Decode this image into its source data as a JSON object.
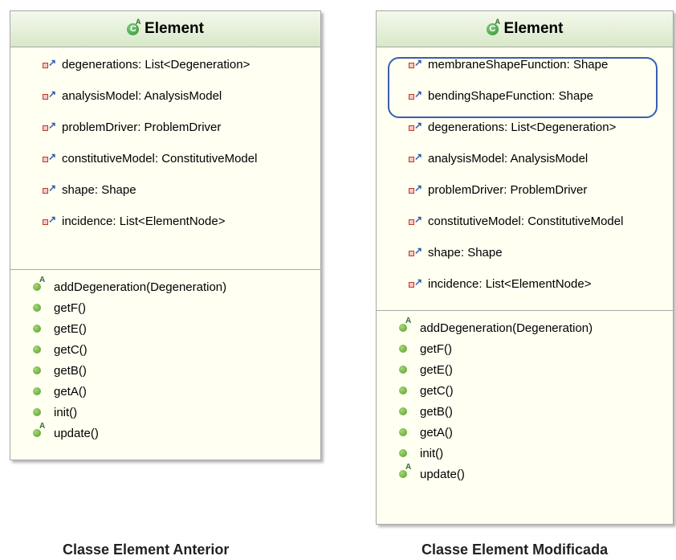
{
  "left_class": {
    "name": "Element",
    "fields": [
      "degenerations: List<Degeneration>",
      "analysisModel: AnalysisModel",
      "problemDriver: ProblemDriver",
      "constitutiveModel: ConstitutiveModel",
      "shape: Shape",
      "incidence: List<ElementNode>"
    ],
    "methods": [
      {
        "label": "addDegeneration(Degeneration)",
        "abstract": true
      },
      {
        "label": "getF()",
        "abstract": false
      },
      {
        "label": "getE()",
        "abstract": false
      },
      {
        "label": "getC()",
        "abstract": false
      },
      {
        "label": "getB()",
        "abstract": false
      },
      {
        "label": "getA()",
        "abstract": false
      },
      {
        "label": "init()",
        "abstract": false
      },
      {
        "label": "update()",
        "abstract": true
      }
    ]
  },
  "right_class": {
    "name": "Element",
    "fields": [
      "membraneShapeFunction: Shape",
      "bendingShapeFunction: Shape",
      "degenerations: List<Degeneration>",
      "analysisModel: AnalysisModel",
      "problemDriver: ProblemDriver",
      "constitutiveModel: ConstitutiveModel",
      "shape: Shape",
      "incidence: List<ElementNode>"
    ],
    "methods": [
      {
        "label": "addDegeneration(Degeneration)",
        "abstract": true
      },
      {
        "label": "getF()",
        "abstract": false
      },
      {
        "label": "getE()",
        "abstract": false
      },
      {
        "label": "getC()",
        "abstract": false
      },
      {
        "label": "getB()",
        "abstract": false
      },
      {
        "label": "getA()",
        "abstract": false
      },
      {
        "label": "init()",
        "abstract": false
      },
      {
        "label": "update()",
        "abstract": true
      }
    ]
  },
  "captions": {
    "left": "Classe Element Anterior",
    "right": "Classe Element Modificada"
  },
  "icons": {
    "class": "abstract-class-icon",
    "field": "private-field-icon",
    "method": "public-method-icon",
    "abstract_method": "abstract-method-icon"
  },
  "colors": {
    "highlight": "#3a5fb0",
    "header_top": "#f4f9ec",
    "header_bottom": "#d8e8c8",
    "body": "#fffff2"
  }
}
